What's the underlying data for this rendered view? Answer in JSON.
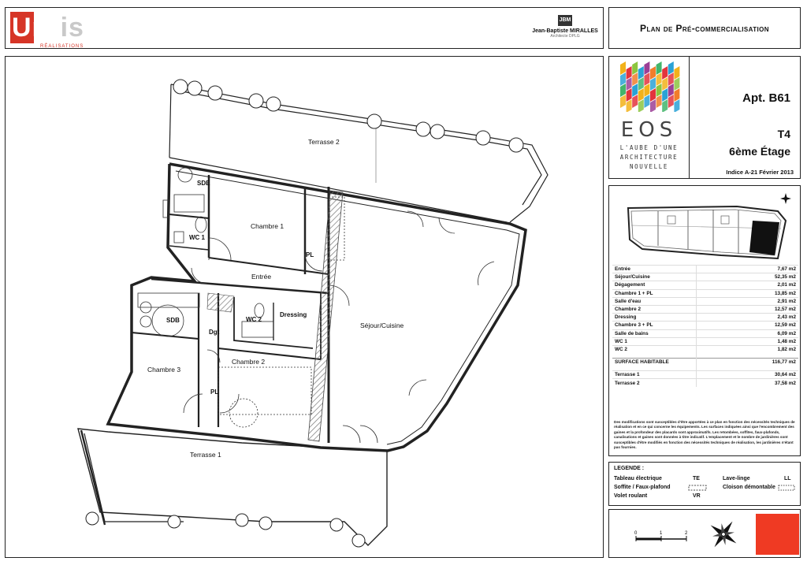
{
  "header": {
    "brand_word_main": "Urb",
    "brand_word_tail": "is",
    "brand_sub": "RÉALISATIONS",
    "architect_mark": "JBM",
    "architect_name": "Jean-Baptiste MIRALLES",
    "architect_sub": "Architecte DPLG"
  },
  "title": "Plan de Pré-commercialisation",
  "project": {
    "name": "EOS",
    "tagline": [
      "L'AUBE D'UNE",
      "ARCHITECTURE",
      "NOUVELLE"
    ],
    "apartment": "Apt. B61",
    "type": "T4",
    "floor": "6ème Étage",
    "index": "Indice A-21 Février 2013"
  },
  "rooms": {
    "terrasse_2": "Terrasse 2",
    "terrasse_1": "Terrasse 1",
    "sde": "SDE",
    "wc1": "WC 1",
    "chambre1": "Chambre 1",
    "pl1": "PL",
    "entree": "Entrée",
    "sejour": "Séjour/Cuisine",
    "sdb": "SDB",
    "dgt": "Dgt",
    "wc2": "WC 2",
    "dressing": "Dressing",
    "chambre2": "Chambre 2",
    "chambre3": "Chambre 3",
    "pl3": "PL"
  },
  "surfaces": [
    {
      "label": "Entrée",
      "value": "7,67 m2"
    },
    {
      "label": "Séjour/Cuisine",
      "value": "52,35 m2"
    },
    {
      "label": "Dégagement",
      "value": "2,01 m2"
    },
    {
      "label": "Chambre 1 + PL",
      "value": "13,85 m2"
    },
    {
      "label": "Salle d'eau",
      "value": "2,91 m2"
    },
    {
      "label": "Chambre 2",
      "value": "12,57 m2"
    },
    {
      "label": "Dressing",
      "value": "2,43 m2"
    },
    {
      "label": "Chambre 3 + PL",
      "value": "12,59 m2"
    },
    {
      "label": "Salle de bains",
      "value": "6,09 m2"
    },
    {
      "label": "WC 1",
      "value": "1,48 m2"
    },
    {
      "label": "WC 2",
      "value": "1,82 m2"
    }
  ],
  "surface_total": {
    "label": "SURFACE HABITABLE",
    "value": "116,77 m2"
  },
  "terraces": [
    {
      "label": "Terrasse 1",
      "value": "30,64 m2"
    },
    {
      "label": "Terrasse 2",
      "value": "37,58 m2"
    }
  ],
  "notes": "Des modifications sont susceptibles d'être apportées à ce plan en fonction des nécessités techniques de réalisation et en ce qui concerne les équipements. Les surfaces indiquées ainsi que l'encombrement des gaines et la profondeur des placards sont approximatifs. Les retombées, soffites, faux-plafonds, canalisations et gaines sont données à titre indicatif. L'emplacement et le nombre de jardinières sont susceptibles d'être modifiés en fonction des nécessités techniques de réalisation, les jardinières n'étant pas fournies.",
  "legend": {
    "title": "LEGENDE :",
    "items": [
      {
        "label": "Tableau électrique",
        "code": "TE"
      },
      {
        "label": "Soffite / Faux-plafond",
        "code": ""
      },
      {
        "label": "Volet roulant",
        "code": "VR"
      },
      {
        "label": "Lave-linge",
        "code": "LL"
      },
      {
        "label": "Cloison démontable",
        "code": ""
      }
    ]
  },
  "scale": {
    "marks": [
      "0",
      "1",
      "2"
    ]
  },
  "colors": {
    "brand_red": "#ef3a23",
    "urbis_red": "#d63527",
    "hatch": "#888888"
  }
}
